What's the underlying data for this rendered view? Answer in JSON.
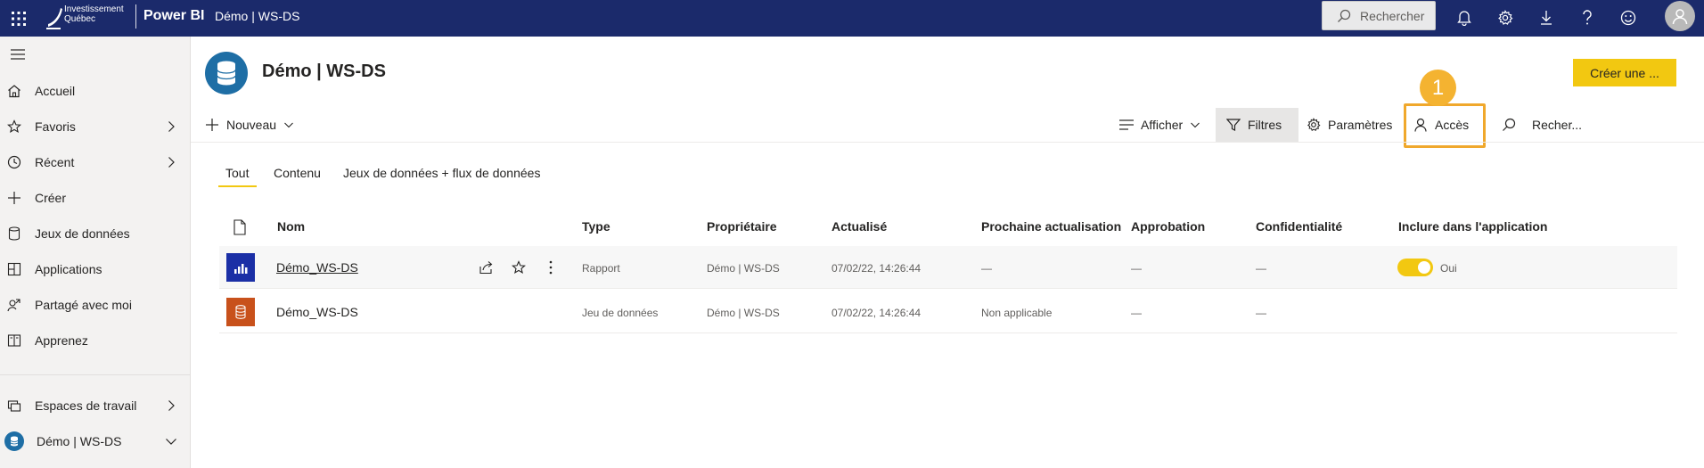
{
  "topbar": {
    "org_line1": "Investissement",
    "org_line2": "Québec",
    "product": "Power BI",
    "breadcrumb": "Démo | WS-DS",
    "search_label": "Rechercher",
    "icons": [
      "waffle-icon",
      "search-icon",
      "bell-icon",
      "gear-icon",
      "download-icon",
      "help-icon",
      "smiley-icon",
      "avatar-icon"
    ],
    "bar_color": "#1b2a6b"
  },
  "sidebar": {
    "items": [
      {
        "label": "Accueil",
        "icon": "home-icon"
      },
      {
        "label": "Favoris",
        "icon": "star-icon",
        "chevron": true
      },
      {
        "label": "Récent",
        "icon": "clock-icon",
        "chevron": true
      },
      {
        "label": "Créer",
        "icon": "plus-icon"
      },
      {
        "label": "Jeux de données",
        "icon": "database-icon"
      },
      {
        "label": "Applications",
        "icon": "apps-icon"
      },
      {
        "label": "Partagé avec moi",
        "icon": "share-person-icon"
      },
      {
        "label": "Apprenez",
        "icon": "book-icon"
      },
      {
        "label": "Espaces de travail",
        "icon": "workspaces-icon",
        "chevron": true
      },
      {
        "label": "Démo | WS-DS",
        "icon": "workspace-db-icon",
        "chevron": true
      }
    ]
  },
  "workspace": {
    "title": "Démo | WS-DS",
    "create_button": "Créer une ..."
  },
  "commands": {
    "new": "Nouveau",
    "view": "Afficher",
    "filters": "Filtres",
    "settings": "Paramètres",
    "access": "Accès",
    "search": "Recher...",
    "callout_number": "1",
    "highlight_color": "#f0a82c"
  },
  "tabs": [
    "Tout",
    "Contenu",
    "Jeux de données + flux de données"
  ],
  "table": {
    "headers": [
      "Nom",
      "Type",
      "Propriétaire",
      "Actualisé",
      "Prochaine actualisation",
      "Approbation",
      "Confidentialité",
      "Inclure dans l'application"
    ],
    "rows": [
      {
        "icon": "report-icon",
        "icon_color": "#1b2fa6",
        "name": "Démo_WS-DS",
        "type": "Rapport",
        "owner": "Démo | WS-DS",
        "refreshed": "07/02/22, 14:26:44",
        "next_refresh": "—",
        "endorsement": "—",
        "sensitivity": "—",
        "include_in_app": "Oui"
      },
      {
        "icon": "dataset-icon",
        "icon_color": "#c8511b",
        "name": "Démo_WS-DS",
        "type": "Jeu de données",
        "owner": "Démo | WS-DS",
        "refreshed": "07/02/22, 14:26:44",
        "next_refresh": "Non applicable",
        "endorsement": "—",
        "sensitivity": "—"
      }
    ]
  }
}
